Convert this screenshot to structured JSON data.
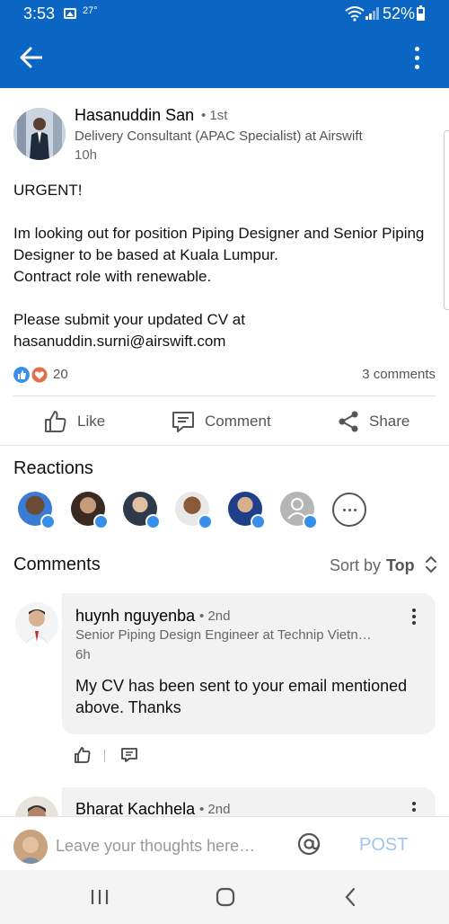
{
  "status_bar": {
    "time": "3:53",
    "temperature": "27°",
    "battery": "52%"
  },
  "post": {
    "author_name": "Hasanuddin San",
    "degree": "• 1st",
    "headline": "Delivery Consultant (APAC Specialist) at Airswift",
    "time_ago": "10h",
    "body": [
      "URGENT!",
      "",
      "Im looking out for position Piping Designer and Senior Piping Designer to be based at Kuala Lumpur.",
      "Contract role with renewable.",
      "",
      "Please submit your updated CV at hasanuddin.surni@airswift.com"
    ],
    "reaction_count": "20",
    "comment_count": "3 comments"
  },
  "actions": {
    "like": "Like",
    "comment": "Comment",
    "share": "Share"
  },
  "reactions_section": {
    "title": "Reactions"
  },
  "comments_section": {
    "title": "Comments",
    "sort_label": "Sort by",
    "sort_value": "Top",
    "comments": [
      {
        "name": "huynh nguyenba",
        "degree": "• 2nd",
        "headline": "Senior Piping Design Engineer at Technip Vietn…",
        "time": "6h",
        "text": "My CV has been sent to your email mentioned above. Thanks"
      },
      {
        "name": "Bharat Kachhela",
        "degree": "• 2nd"
      }
    ]
  },
  "composer": {
    "placeholder": "Leave your thoughts here…",
    "post_label": "POST"
  },
  "colors": {
    "brand": "#0a66c2",
    "like_blue": "#378fe9",
    "love_red": "#df704d",
    "post_disabled": "#9ec6ec"
  }
}
